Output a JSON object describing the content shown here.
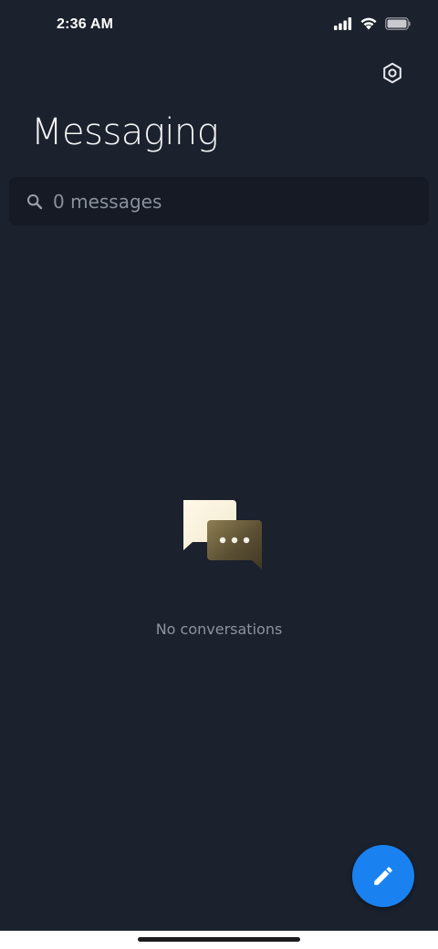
{
  "status_bar": {
    "time": "2:36 AM",
    "icons": [
      "signal-icon",
      "wifi-icon",
      "battery-icon"
    ]
  },
  "header": {
    "title": "Messaging",
    "settings_icon": "settings-icon"
  },
  "search": {
    "placeholder": "0 messages",
    "icon": "search-icon"
  },
  "empty_state": {
    "icon": "chat-bubbles-icon",
    "label": "No conversations"
  },
  "fab": {
    "icon": "pencil-icon"
  },
  "colors": {
    "background": "#1b212d",
    "search_background": "#151a24",
    "accent": "#1a82f0",
    "muted_text": "#8c939e"
  }
}
